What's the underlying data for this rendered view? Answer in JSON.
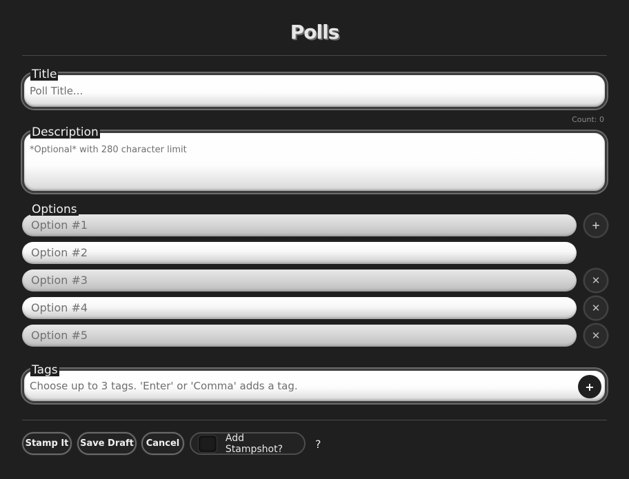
{
  "header": {
    "title": "Polls"
  },
  "title_field": {
    "label": "Title",
    "placeholder": "Poll Title...",
    "count": "Count: 0"
  },
  "description_field": {
    "label": "Description",
    "placeholder": "*Optional* with 280 character limit"
  },
  "options": {
    "label": "Options",
    "items": [
      {
        "placeholder": "Option #1",
        "action": "add"
      },
      {
        "placeholder": "Option #2",
        "action": "none"
      },
      {
        "placeholder": "Option #3",
        "action": "remove"
      },
      {
        "placeholder": "Option #4",
        "action": "remove"
      },
      {
        "placeholder": "Option #5",
        "action": "remove"
      }
    ],
    "add_glyph": "+",
    "remove_glyph": "✕"
  },
  "tags_field": {
    "label": "Tags",
    "placeholder": "Choose up to 3 tags. 'Enter' or 'Comma' adds a tag.",
    "add_glyph": "+"
  },
  "actions": {
    "stamp_it": "Stamp It",
    "save_draft": "Save Draft",
    "cancel": "Cancel",
    "add_stampshot": "Add Stampshot?",
    "help": "?"
  }
}
